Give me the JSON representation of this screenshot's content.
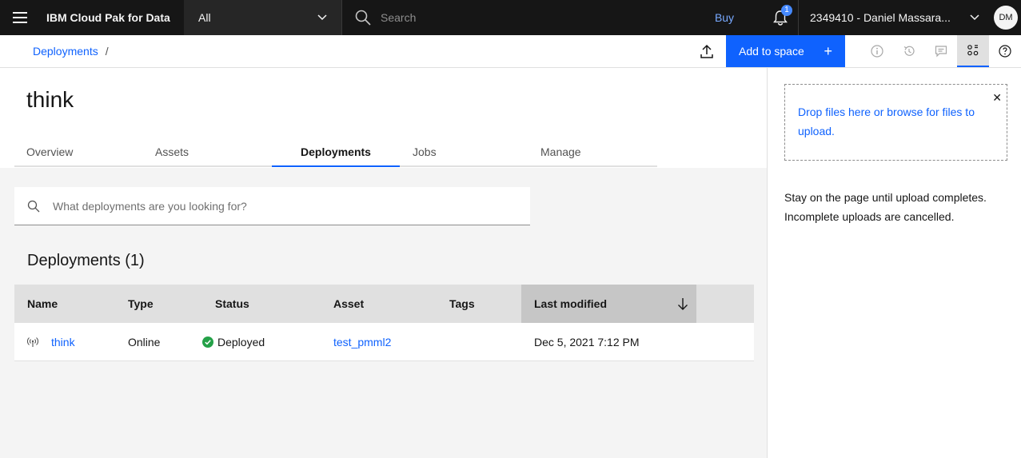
{
  "topbar": {
    "product": "IBM Cloud Pak for Data",
    "scope": "All",
    "search_placeholder": "Search",
    "buy": "Buy",
    "notification_count": "1",
    "account": "2349410 - Daniel Massara...",
    "avatar_initials": "DM"
  },
  "subheader": {
    "breadcrumb_link": "Deployments",
    "breadcrumb_sep": "/",
    "add_to_space": "Add to space",
    "add_icon": "+"
  },
  "page": {
    "title": "think",
    "tabs": [
      "Overview",
      "Assets",
      "Deployments",
      "Jobs",
      "Manage"
    ],
    "active_tab": "Deployments",
    "search_placeholder": "What deployments are you looking for?",
    "section_title": "Deployments (1)"
  },
  "table": {
    "headers": [
      "Name",
      "Type",
      "Status",
      "Asset",
      "Tags",
      "Last modified"
    ],
    "sorted_column": "Last modified",
    "rows": [
      {
        "name": "think",
        "type": "Online",
        "status": "Deployed",
        "asset": "test_pmml2",
        "tags": "",
        "last_modified": "Dec 5, 2021 7:12 PM"
      }
    ]
  },
  "panel": {
    "dropzone_text": "Drop files here or browse for files to upload.",
    "note": "Stay on the page until upload completes. Incomplete uploads are cancelled."
  },
  "colors": {
    "accent": "#0f62fe",
    "topbar": "#161616",
    "success": "#24a148"
  }
}
